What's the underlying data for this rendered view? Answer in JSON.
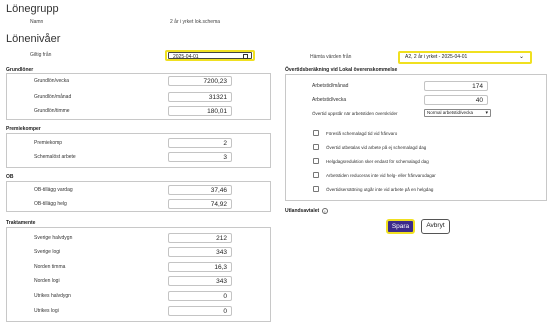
{
  "heading_group": "Lönegrupp",
  "name_label": "Namn",
  "name_value": "2 år i yrket lok.schema",
  "heading_levels": "Lönenivåer",
  "valid_from_label": "Giltig från",
  "valid_from_value": "2025-04-01",
  "fetch_label": "Hämta värden från",
  "fetch_value": "A2, 2 år i yrket - 2025-04-01",
  "sections": {
    "grundloner": {
      "title": "Grundlöner",
      "rows": [
        {
          "label": "Grundlön/vecka",
          "value": "7200,23"
        },
        {
          "label": "Grundlön/månad",
          "value": "31321"
        },
        {
          "label": "Grundlön/timme",
          "value": "180,01"
        }
      ]
    },
    "premiekomper": {
      "title": "Premiekomper",
      "rows": [
        {
          "label": "Premiekomp",
          "value": "2"
        },
        {
          "label": "Schemalöst arbete",
          "value": "3"
        }
      ]
    },
    "ob": {
      "title": "OB",
      "rows": [
        {
          "label": "OB-tillägg vardag",
          "value": "37,46"
        },
        {
          "label": "OB-tillägg helg",
          "value": "74,92"
        }
      ]
    },
    "traktamente": {
      "title": "Traktamente",
      "rows": [
        {
          "label": "Sverige halvdygn",
          "value": "212"
        },
        {
          "label": "Sverige logi",
          "value": "343"
        },
        {
          "label": "Norden timma",
          "value": "16,3"
        },
        {
          "label": "Norden logi",
          "value": "343"
        },
        {
          "label": "Utrikes halvdygn",
          "value": "0"
        },
        {
          "label": "Utrikes logi",
          "value": "0"
        }
      ]
    }
  },
  "overtime": {
    "title": "Övertidsberäkning vid Lokal överenskommelse",
    "rows": [
      {
        "label": "Arbetstid/månad",
        "value": "174"
      },
      {
        "label": "Arbetstid/vecka",
        "value": "40"
      }
    ],
    "arises_label": "Övertid uppstår när arbetstiden överskrider",
    "arises_value": "Normal arbetstid/vecka",
    "checkboxes": [
      "Föreslå schemalagd tid vid frånvaro",
      "Övertid utbetalas vid arbete på ej schemalagd dag",
      "Helgdagsreduktion sker endast för schemalagd dag",
      "Arbetstiden reduceras inte vid helg- eller frånvarodagar",
      "Övertidsersättning utgår inte vid arbete på en helgdag"
    ]
  },
  "utlandsavtalet": "Utlandsavtalet",
  "save_label": "Spara",
  "cancel_label": "Avbryt"
}
